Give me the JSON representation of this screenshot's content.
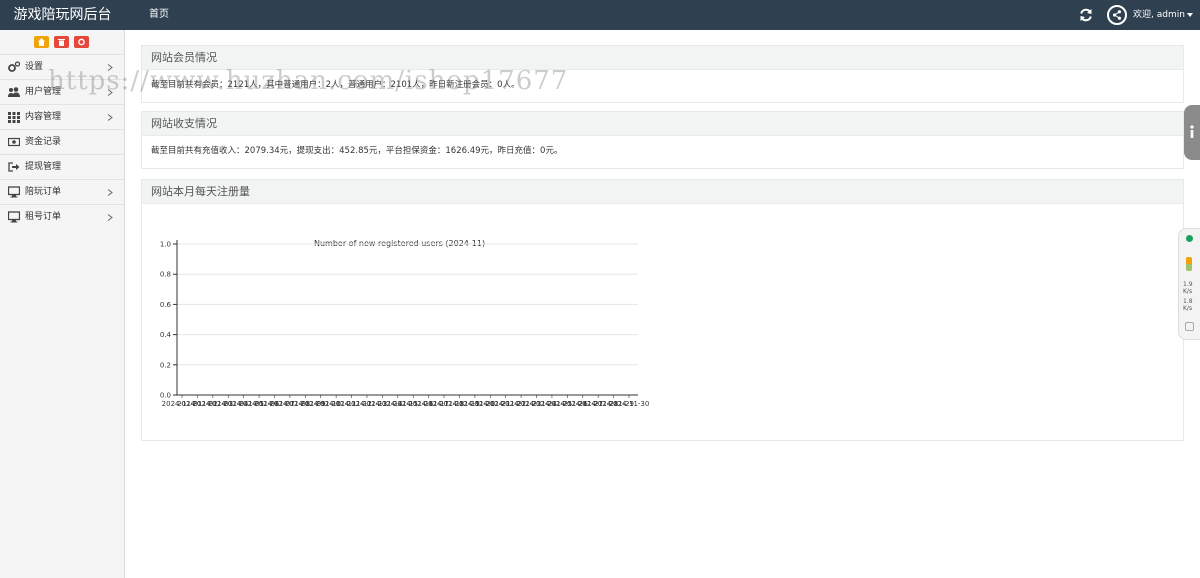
{
  "header": {
    "brand": "游戏陪玩网后台",
    "nav_home": "首页",
    "user_label": "欢迎, admin",
    "colors": {
      "topbar": "#2f4050"
    }
  },
  "sidebar": {
    "shortcuts": [
      {
        "icon": "home-icon",
        "color": "#f0a30a"
      },
      {
        "icon": "trash-icon",
        "color": "#e5473b"
      },
      {
        "icon": "settings-icon",
        "color": "#e5473b"
      }
    ],
    "items": [
      {
        "label": "设置",
        "icon": "gears-icon",
        "has_arrow": true
      },
      {
        "label": "用户管理",
        "icon": "users-icon",
        "has_arrow": true
      },
      {
        "label": "内容管理",
        "icon": "grid-icon",
        "has_arrow": true
      },
      {
        "label": "资金记录",
        "icon": "money-icon",
        "has_arrow": false
      },
      {
        "label": "提现管理",
        "icon": "sign-out-icon",
        "has_arrow": false
      },
      {
        "label": "陪玩订单",
        "icon": "desktop-icon",
        "has_arrow": true
      },
      {
        "label": "租号订单",
        "icon": "desktop-icon",
        "has_arrow": true
      }
    ]
  },
  "panels": {
    "members": {
      "title": "网站会员情况",
      "text": "截至目前共有会员：2121人，其中普通用户：2人，普通用户：2101人，昨日新注册会员：0人。"
    },
    "finance": {
      "title": "网站收支情况",
      "text": "截至目前共有充值收入：2079.34元，提现支出：452.85元，平台担保资金：1626.49元，昨日充值：0元。"
    },
    "registrations": {
      "title": "网站本月每天注册量"
    }
  },
  "watermark": "https://www.huzhan.com/ishop17677",
  "monitor": {
    "upload": "1.9",
    "download": "1.8",
    "unit": "K/s"
  },
  "chart_data": {
    "type": "line",
    "title": "Number of new registered users (2024-11)",
    "x": [
      "2024-11-01",
      "2024-11-02",
      "2024-11-03",
      "2024-11-04",
      "2024-11-05",
      "2024-11-06",
      "2024-11-07",
      "2024-11-08",
      "2024-11-09",
      "2024-11-10",
      "2024-11-11",
      "2024-11-12",
      "2024-11-13",
      "2024-11-14",
      "2024-11-15",
      "2024-11-16",
      "2024-11-17",
      "2024-11-18",
      "2024-11-19",
      "2024-11-20",
      "2024-11-21",
      "2024-11-22",
      "2024-11-23",
      "2024-11-24",
      "2024-11-25",
      "2024-11-26",
      "2024-11-27",
      "2024-11-28",
      "2024-11-29",
      "2024-11-30"
    ],
    "series": [
      {
        "values": [
          0,
          0,
          0,
          0,
          0,
          0,
          0,
          0,
          0,
          0,
          0,
          0,
          0,
          0,
          0,
          0,
          0,
          0,
          0,
          0,
          0,
          0,
          0,
          0,
          0,
          0,
          0,
          0,
          0,
          0
        ]
      }
    ],
    "y_ticks": [
      "0.0",
      "0.2",
      "0.4",
      "0.6",
      "0.8",
      "1.0"
    ],
    "ylim": [
      0,
      1
    ],
    "grid": true
  }
}
